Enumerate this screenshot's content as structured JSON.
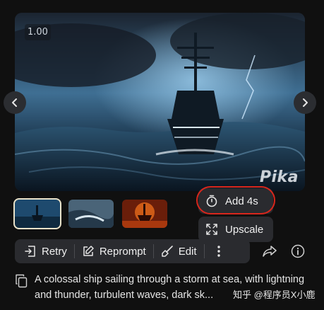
{
  "player": {
    "time": "1.00",
    "watermark": "Pika"
  },
  "popover": {
    "add_label": "Add 4s",
    "upscale_label": "Upscale"
  },
  "toolbar": {
    "retry": "Retry",
    "reprompt": "Reprompt",
    "edit": "Edit"
  },
  "prompt": {
    "text": "A colossal ship sailing through a storm at sea, with lightning and thunder, turbulent waves, dark sk..."
  },
  "credit": "知乎 @程序员X小鹿",
  "colors": {
    "background": "#101010",
    "panel": "#2a2b2f",
    "highlight_ring": "#d9261c"
  }
}
